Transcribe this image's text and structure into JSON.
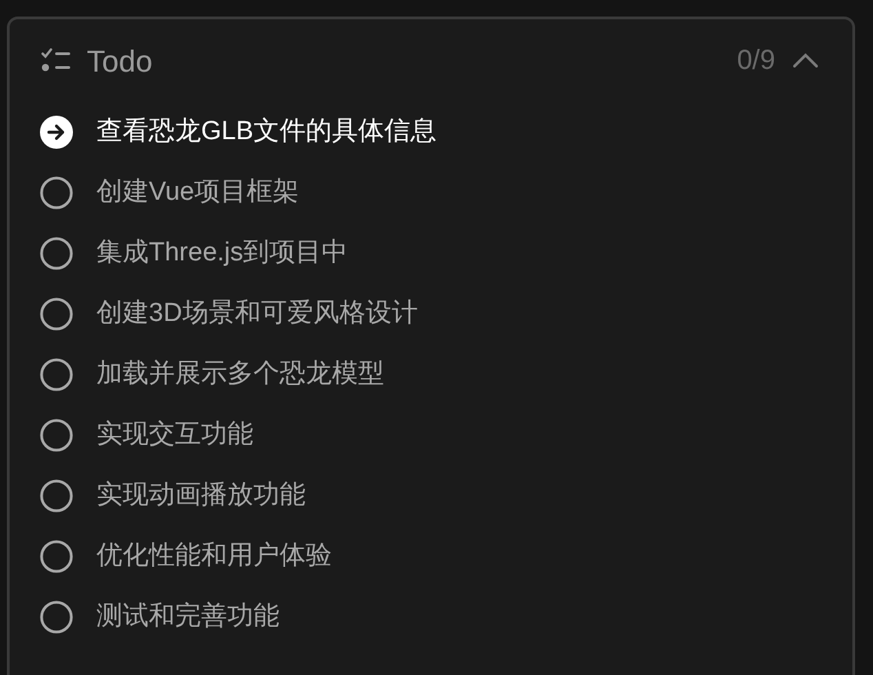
{
  "panel": {
    "title": "Todo",
    "count": "0/9",
    "expanded": true
  },
  "todos": [
    {
      "text": "查看恐龙GLB文件的具体信息",
      "kind": "current"
    },
    {
      "text": "创建Vue项目框架",
      "kind": "pending"
    },
    {
      "text": "集成Three.js到项目中",
      "kind": "pending"
    },
    {
      "text": "创建3D场景和可爱风格设计",
      "kind": "pending"
    },
    {
      "text": "加载并展示多个恐龙模型",
      "kind": "pending"
    },
    {
      "text": "实现交互功能",
      "kind": "pending"
    },
    {
      "text": "实现动画播放功能",
      "kind": "pending"
    },
    {
      "text": "优化性能和用户体验",
      "kind": "pending"
    },
    {
      "text": "测试和完善功能",
      "kind": "pending"
    }
  ]
}
